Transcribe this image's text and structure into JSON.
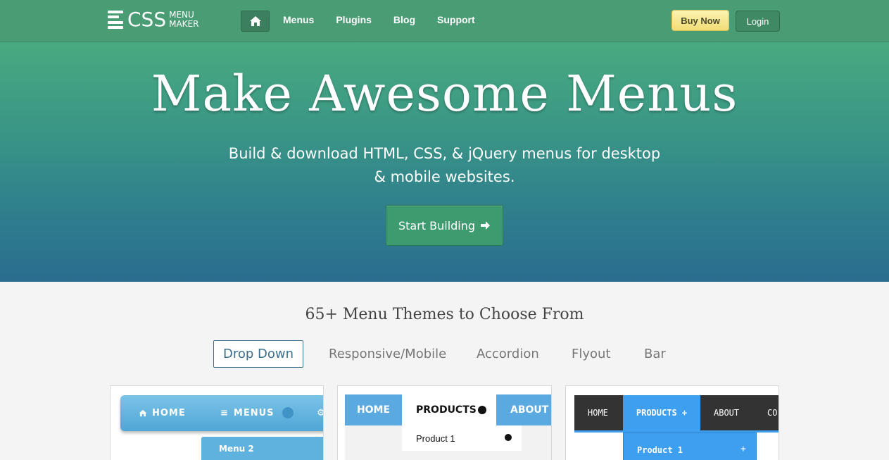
{
  "navbar": {
    "logo_main": "CSS",
    "logo_sub1": "MENU",
    "logo_sub2": "MAKER",
    "home_icon": "home-icon",
    "links": [
      "Menus",
      "Plugins",
      "Blog",
      "Support"
    ],
    "buy_label": "Buy Now",
    "login_label": "Login"
  },
  "hero": {
    "title": "Make Awesome Menus",
    "subtitle_line1": "Build & download HTML, CSS, & jQuery menus for desktop",
    "subtitle_line2": "& mobile websites.",
    "cta_label": "Start Building",
    "cta_icon": "arrow-right-icon"
  },
  "themes": {
    "title": "65+ Menu Themes to Choose From",
    "tabs": [
      "Drop Down",
      "Responsive/Mobile",
      "Accordion",
      "Flyout",
      "Bar"
    ],
    "active_tab": "Drop Down"
  },
  "previews": {
    "card1": {
      "home": "HOME",
      "menus": "MENUS",
      "sub": "Menu 2"
    },
    "card2": {
      "home": "HOME",
      "products": "PRODUCTS",
      "about": "ABOUT",
      "sub": "Product 1"
    },
    "card3": {
      "home": "HOME",
      "products": "PRODUCTS +",
      "about": "ABOUT",
      "contact": "CO",
      "sub": "Product 1",
      "sub_plus": "+"
    }
  },
  "colors": {
    "nav_bg": "#4a9c74",
    "hero_top": "#48aa80",
    "hero_bottom": "#2a6d8e",
    "accent_blue": "#3e9ff0",
    "buy_yellow": "#f1dd77"
  }
}
